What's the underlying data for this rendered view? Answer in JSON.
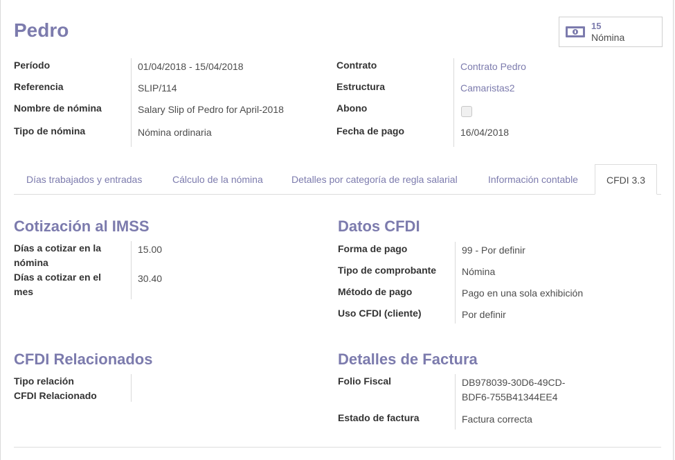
{
  "record": {
    "name": "Pedro"
  },
  "stat_button": {
    "value": "15",
    "label": "Nómina",
    "icon": "money-icon"
  },
  "header_left": [
    {
      "label": "Período",
      "value": "01/04/2018 - 15/04/2018"
    },
    {
      "label": "Referencia",
      "value": "SLIP/114"
    },
    {
      "label": "Nombre de nómina",
      "value": "Salary Slip of Pedro for April-2018"
    },
    {
      "label": "Tipo de nómina",
      "value": "Nómina ordinaria"
    }
  ],
  "header_right": {
    "contrato": {
      "label": "Contrato",
      "value": "Contrato Pedro"
    },
    "estructura": {
      "label": "Estructura",
      "value": "Camaristas2"
    },
    "abono": {
      "label": "Abono",
      "checked": false
    },
    "fecha_pago": {
      "label": "Fecha de pago",
      "value": "16/04/2018"
    }
  },
  "tabs": [
    {
      "label": "Días trabajados y entradas"
    },
    {
      "label": "Cálculo de la nómina"
    },
    {
      "label": "Detalles por categoría de regla salarial"
    },
    {
      "label": "Información contable"
    },
    {
      "label": "CFDI 3.3",
      "active": true
    }
  ],
  "cotizacion": {
    "title": "Cotización al IMSS",
    "fields": [
      {
        "label_line1": "Días a cotizar en la",
        "label_line2": "nómina",
        "value": "15.00"
      },
      {
        "label_line1": "Días a cotizar en el",
        "label_line2": "mes",
        "value": "30.40"
      }
    ]
  },
  "datos_cfdi": {
    "title": "Datos CFDI",
    "fields": [
      {
        "label": "Forma de pago",
        "value": "99 - Por definir"
      },
      {
        "label": "Tipo de comprobante",
        "value": "Nómina"
      },
      {
        "label": "Método de pago",
        "value": "Pago en una sola exhibición"
      },
      {
        "label": "Uso CFDI (cliente)",
        "value": "Por definir"
      }
    ]
  },
  "cfdi_relacionados": {
    "title": "CFDI Relacionados",
    "fields": [
      {
        "label": "Tipo relación",
        "value": ""
      },
      {
        "label": "CFDI Relacionado",
        "value": ""
      }
    ]
  },
  "detalles_factura": {
    "title": "Detalles de Factura",
    "fields": [
      {
        "label": "Folio Fiscal",
        "value_line1": "DB978039-30D6-49CD-",
        "value_line2": "BDF6-755B41344EE4"
      },
      {
        "label": "Estado de factura",
        "value": "Factura correcta"
      }
    ]
  },
  "colors": {
    "accent": "#7c7bad",
    "text": "#4c4c4c",
    "label": "#333333",
    "border": "#d9d9d9"
  }
}
